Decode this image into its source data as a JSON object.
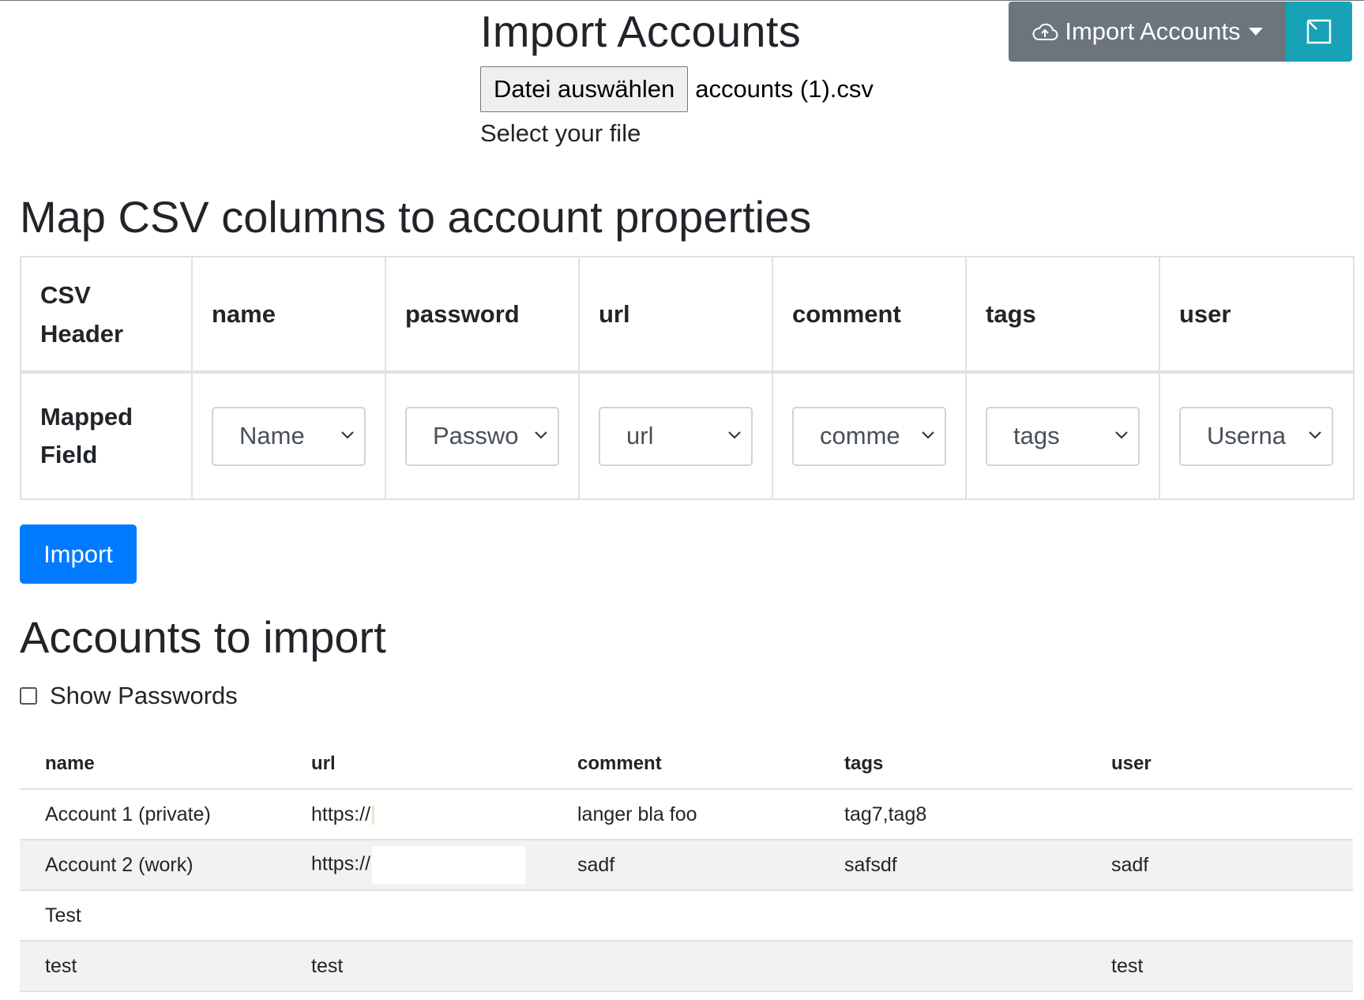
{
  "header": {
    "title": "Import Accounts",
    "file_button": "Datei auswählen",
    "file_name": "accounts (1).csv",
    "file_help": "Select your file",
    "dropdown_label": "Import Accounts"
  },
  "mapping": {
    "title": "Map CSV columns to account properties",
    "row_header_1": "CSV Header",
    "row_header_2": "Mapped Field",
    "columns": [
      "name",
      "password",
      "url",
      "comment",
      "tags",
      "user"
    ],
    "selected": [
      "Name",
      "Passwo",
      "url",
      "comme",
      "tags",
      "Userna"
    ]
  },
  "import_button": "Import",
  "accounts": {
    "title": "Accounts to import",
    "show_passwords": "Show Passwords",
    "headers": [
      "name",
      "url",
      "comment",
      "tags",
      "user"
    ],
    "rows": [
      [
        "Account 1 (private)",
        "https://",
        "langer bla foo",
        "tag7,tag8",
        ""
      ],
      [
        "Account 2 (work)",
        "https://",
        "sadf",
        "safsdf",
        "sadf"
      ],
      [
        "Test",
        "",
        "",
        "",
        ""
      ],
      [
        "test",
        "test",
        "",
        "",
        "test"
      ]
    ]
  },
  "colors": {
    "primary": "#007bff",
    "secondary": "#6c757d",
    "info": "#17a2b8"
  }
}
